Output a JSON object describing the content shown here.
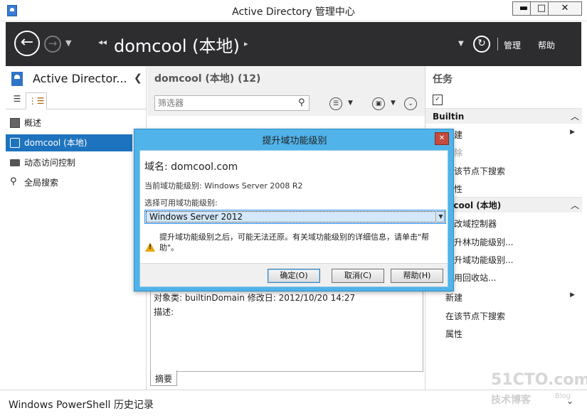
{
  "window": {
    "title": "Active Directory 管理中心",
    "minimize": "▬",
    "maximize": "□",
    "close": "✕"
  },
  "nav": {
    "breadcrumb_left": "◂◂",
    "current": "domcool (本地)",
    "breadcrumb_right": "▸",
    "manage": "管理",
    "help": "帮助"
  },
  "left": {
    "title": "Active Director...",
    "items": [
      {
        "label": "概述"
      },
      {
        "label": "domcool (本地)"
      },
      {
        "label": "动态访问控制"
      },
      {
        "label": "全局搜索"
      }
    ]
  },
  "center": {
    "title": "domcool (本地)  (12)",
    "filter_placeholder": "筛选器",
    "details_row": "对象类:  builtinDomain                        修改日:   2012/10/20 14:27",
    "details_desc": "描述:",
    "summary_tab": "摘要"
  },
  "right": {
    "title": "任务",
    "section1": "Builtin",
    "section1_items": [
      {
        "label": "新建",
        "disabled": false
      },
      {
        "label": "删除",
        "disabled": true
      },
      {
        "label": "在该节点下搜索",
        "disabled": false
      },
      {
        "label": "属性",
        "disabled": false
      }
    ],
    "section2": "domcool (本地)",
    "section2_items": [
      {
        "label": "更改域控制器"
      },
      {
        "label": "提升林功能级别..."
      },
      {
        "label": "提升域功能级别..."
      },
      {
        "label": "启用回收站..."
      },
      {
        "label": "新建"
      },
      {
        "label": "在该节点下搜索"
      },
      {
        "label": "属性"
      }
    ]
  },
  "bottom": {
    "title": "Windows PowerShell 历史记录"
  },
  "dialog": {
    "title": "提升域功能级别",
    "domain": "域名: domcool.com",
    "current_level": "当前域功能级别: Windows Server 2008 R2",
    "select_label": "选择可用域功能级别:",
    "selected": "Windows Server 2012",
    "warning": "提升域功能级别之后，可能无法还原。有关域功能级别的详细信息，请单击\"帮助\"。",
    "ok": "确定(O)",
    "cancel": "取消(C)",
    "help": "帮助(H)"
  },
  "watermark": {
    "line1": "51CTO.com",
    "line2": "技术博客",
    "line3": "Blog"
  }
}
